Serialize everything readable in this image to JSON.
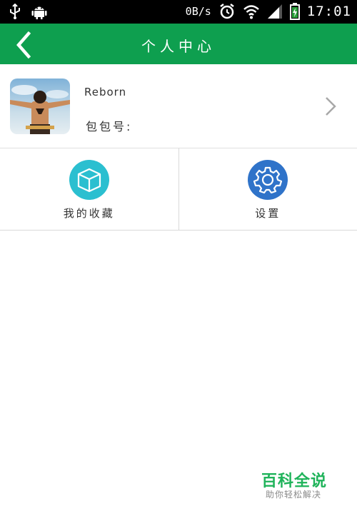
{
  "status_bar": {
    "net_speed": "0B/s",
    "time": "17:01"
  },
  "header": {
    "title": "个人中心"
  },
  "profile": {
    "username": "Reborn",
    "bag_no_label": "包包号:"
  },
  "grid": {
    "favorites_label": "我的收藏",
    "settings_label": "设置"
  },
  "colors": {
    "header_bg": "#0e9f4f",
    "favorites_icon": "#2bbfd0",
    "settings_icon": "#2f73c9"
  },
  "watermark": {
    "main": "百科全说",
    "sub": "助你轻松解决"
  }
}
